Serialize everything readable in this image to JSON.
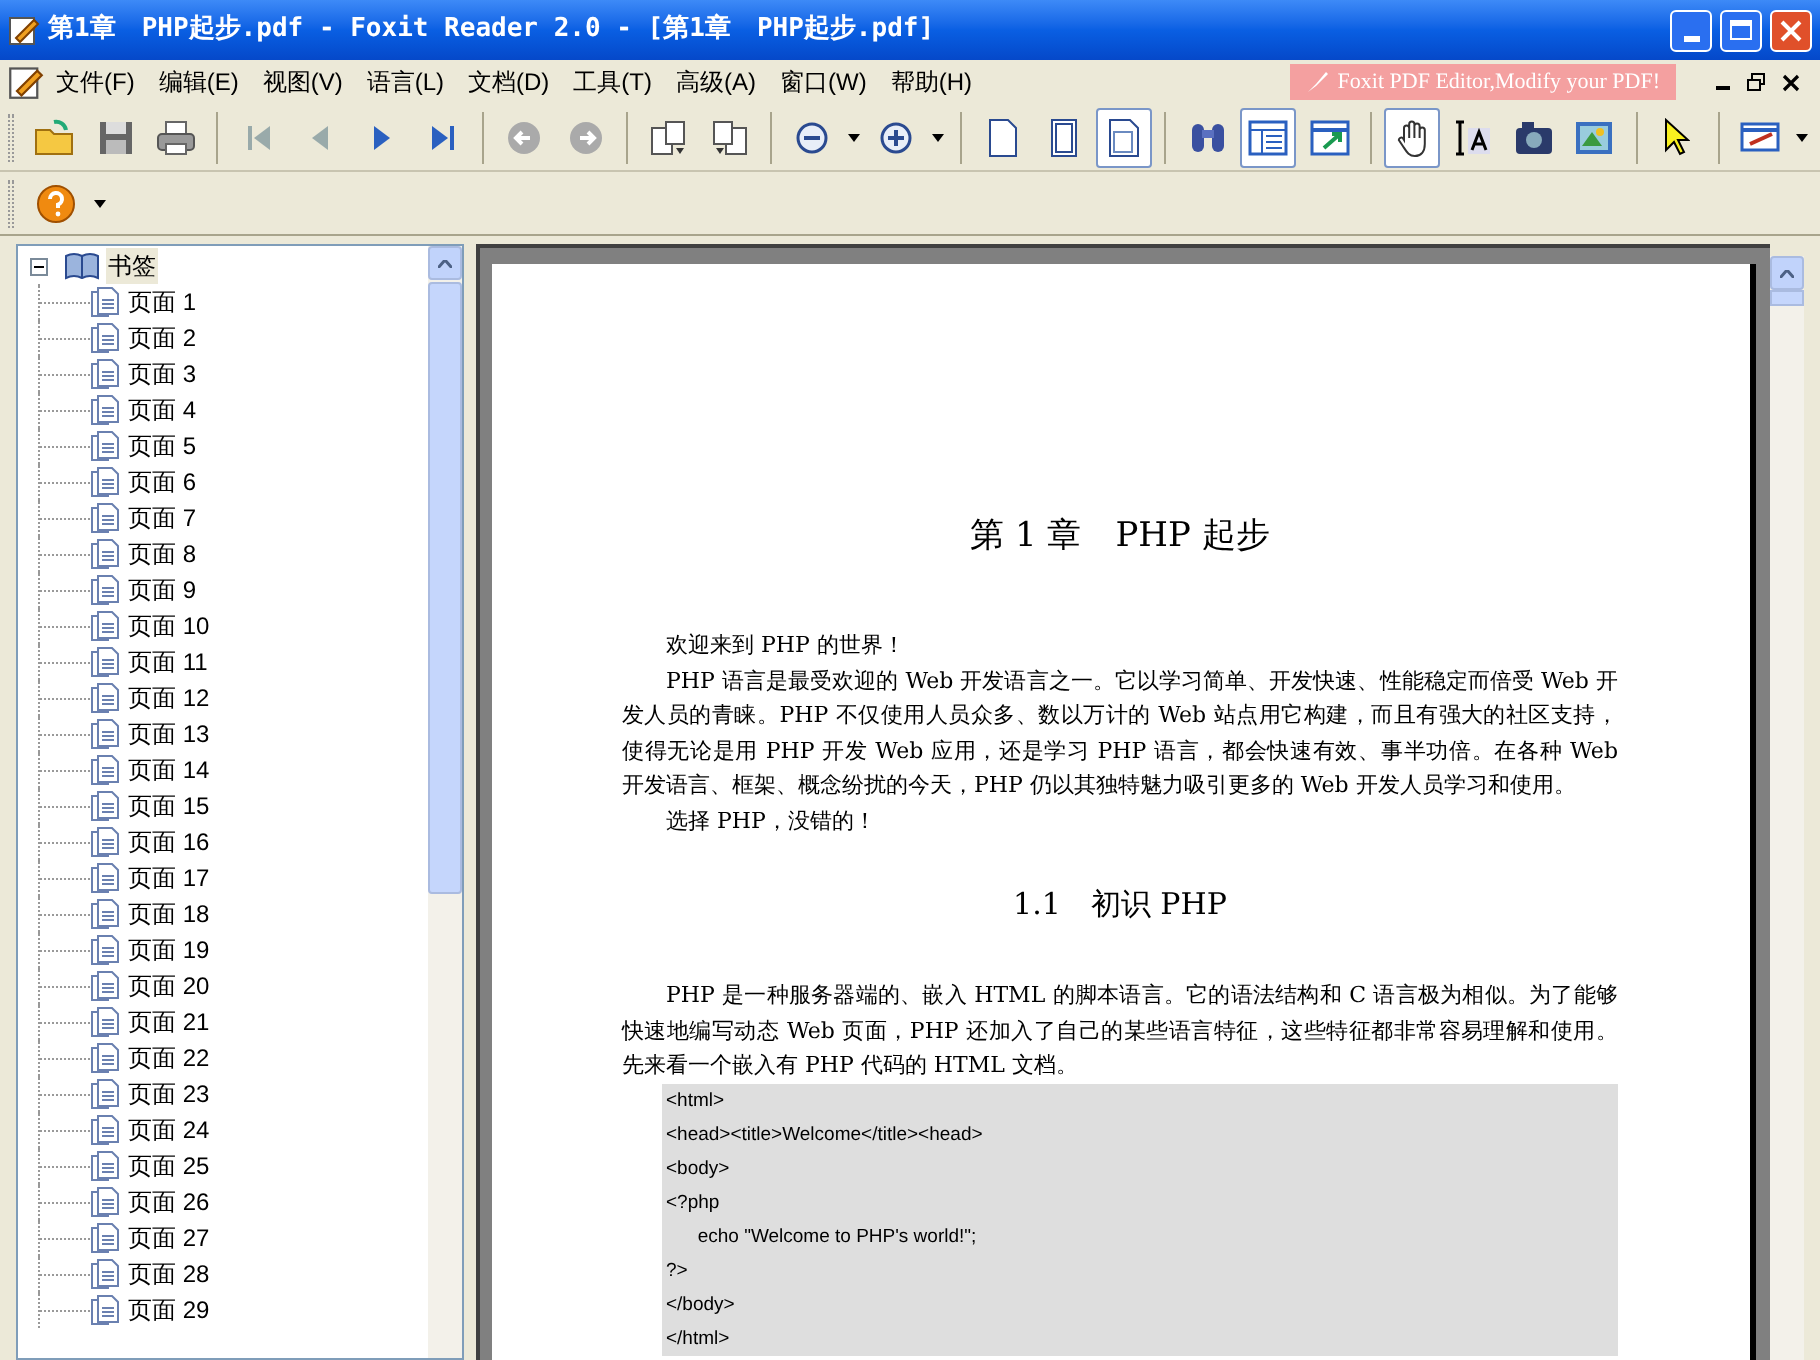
{
  "window": {
    "title": "第1章　PHP起步.pdf - Foxit Reader 2.0 - [第1章　PHP起步.pdf]"
  },
  "menu": [
    "文件(F)",
    "编辑(E)",
    "视图(V)",
    "语言(L)",
    "文档(D)",
    "工具(T)",
    "高级(A)",
    "窗口(W)",
    "帮助(H)"
  ],
  "ad_banner": "Foxit PDF Editor,Modify your PDF!",
  "toolbar": [
    {
      "kind": "open",
      "pressed": false
    },
    {
      "kind": "save",
      "pressed": false
    },
    {
      "kind": "print",
      "pressed": false
    },
    {
      "kind": "sep"
    },
    {
      "kind": "first",
      "pressed": false
    },
    {
      "kind": "prev",
      "pressed": false
    },
    {
      "kind": "next",
      "pressed": false
    },
    {
      "kind": "last",
      "pressed": false
    },
    {
      "kind": "sep"
    },
    {
      "kind": "back",
      "pressed": false
    },
    {
      "kind": "forward",
      "pressed": false
    },
    {
      "kind": "sep"
    },
    {
      "kind": "rotate_cw",
      "pressed": false
    },
    {
      "kind": "rotate_ccw",
      "pressed": false
    },
    {
      "kind": "sep"
    },
    {
      "kind": "zoom_out",
      "pressed": false
    },
    {
      "kind": "zoom_in",
      "pressed": false
    },
    {
      "kind": "sep"
    },
    {
      "kind": "single_page",
      "pressed": false
    },
    {
      "kind": "continuous",
      "pressed": false
    },
    {
      "kind": "facing",
      "pressed": true
    },
    {
      "kind": "sep"
    },
    {
      "kind": "find",
      "pressed": false
    },
    {
      "kind": "bookmarks",
      "pressed": true
    },
    {
      "kind": "fit",
      "pressed": false
    },
    {
      "kind": "sep"
    },
    {
      "kind": "hand",
      "pressed": true
    },
    {
      "kind": "select_text",
      "pressed": false
    },
    {
      "kind": "snapshot",
      "pressed": false
    },
    {
      "kind": "select_image",
      "pressed": false
    },
    {
      "kind": "sep"
    },
    {
      "kind": "pointer",
      "pressed": false
    },
    {
      "kind": "sep"
    },
    {
      "kind": "annotate",
      "pressed": false
    }
  ],
  "bookmarks": {
    "label": "书签",
    "expanded": true,
    "children": [
      {
        "label": "页面 1"
      },
      {
        "label": "页面 2"
      },
      {
        "label": "页面 3"
      },
      {
        "label": "页面 4"
      },
      {
        "label": "页面 5"
      },
      {
        "label": "页面 6"
      },
      {
        "label": "页面 7"
      },
      {
        "label": "页面 8"
      },
      {
        "label": "页面 9"
      },
      {
        "label": "页面 10"
      },
      {
        "label": "页面 11"
      },
      {
        "label": "页面 12"
      },
      {
        "label": "页面 13"
      },
      {
        "label": "页面 14"
      },
      {
        "label": "页面 15"
      },
      {
        "label": "页面 16"
      },
      {
        "label": "页面 17"
      },
      {
        "label": "页面 18"
      },
      {
        "label": "页面 19"
      },
      {
        "label": "页面 20"
      },
      {
        "label": "页面 21"
      },
      {
        "label": "页面 22"
      },
      {
        "label": "页面 23"
      },
      {
        "label": "页面 24"
      },
      {
        "label": "页面 25"
      },
      {
        "label": "页面 26"
      },
      {
        "label": "页面 27"
      },
      {
        "label": "页面 28"
      },
      {
        "label": "页面 29"
      }
    ]
  },
  "document": [
    {
      "kind": "chapter",
      "text": "第 1 章　PHP 起步"
    },
    {
      "kind": "para",
      "text": "欢迎来到 PHP 的世界！"
    },
    {
      "kind": "para",
      "text": "PHP 语言是最受欢迎的 Web 开发语言之一。它以学习简单、开发快速、性能稳定而倍受 Web 开发人员的青睐。PHP 不仅使用人员众多、数以万计的 Web 站点用它构建，而且有强大的社区支持，使得无论是用 PHP 开发 Web 应用，还是学习 PHP 语言，都会快速有效、事半功倍。在各种 Web 开发语言、框架、概念纷扰的今天，PHP 仍以其独特魅力吸引更多的 Web 开发人员学习和使用。"
    },
    {
      "kind": "para",
      "text": "选择 PHP，没错的！"
    },
    {
      "kind": "section",
      "text": "1.1　初识 PHP"
    },
    {
      "kind": "para",
      "text": "PHP 是一种服务器端的、嵌入 HTML 的脚本语言。它的语法结构和 C 语言极为相似。为了能够快速地编写动态 Web 页面，PHP 还加入了自己的某些语言特征，这些特征都非常容易理解和使用。先来看一个嵌入有 PHP 代码的 HTML 文档。"
    },
    {
      "kind": "code",
      "lines": [
        "<html>",
        "<head><title>Welcome</title><head>",
        "<body>",
        "<?php",
        "      echo \"Welcome to PHP's world!\";",
        "?>",
        "</body>",
        "</html>"
      ]
    }
  ]
}
